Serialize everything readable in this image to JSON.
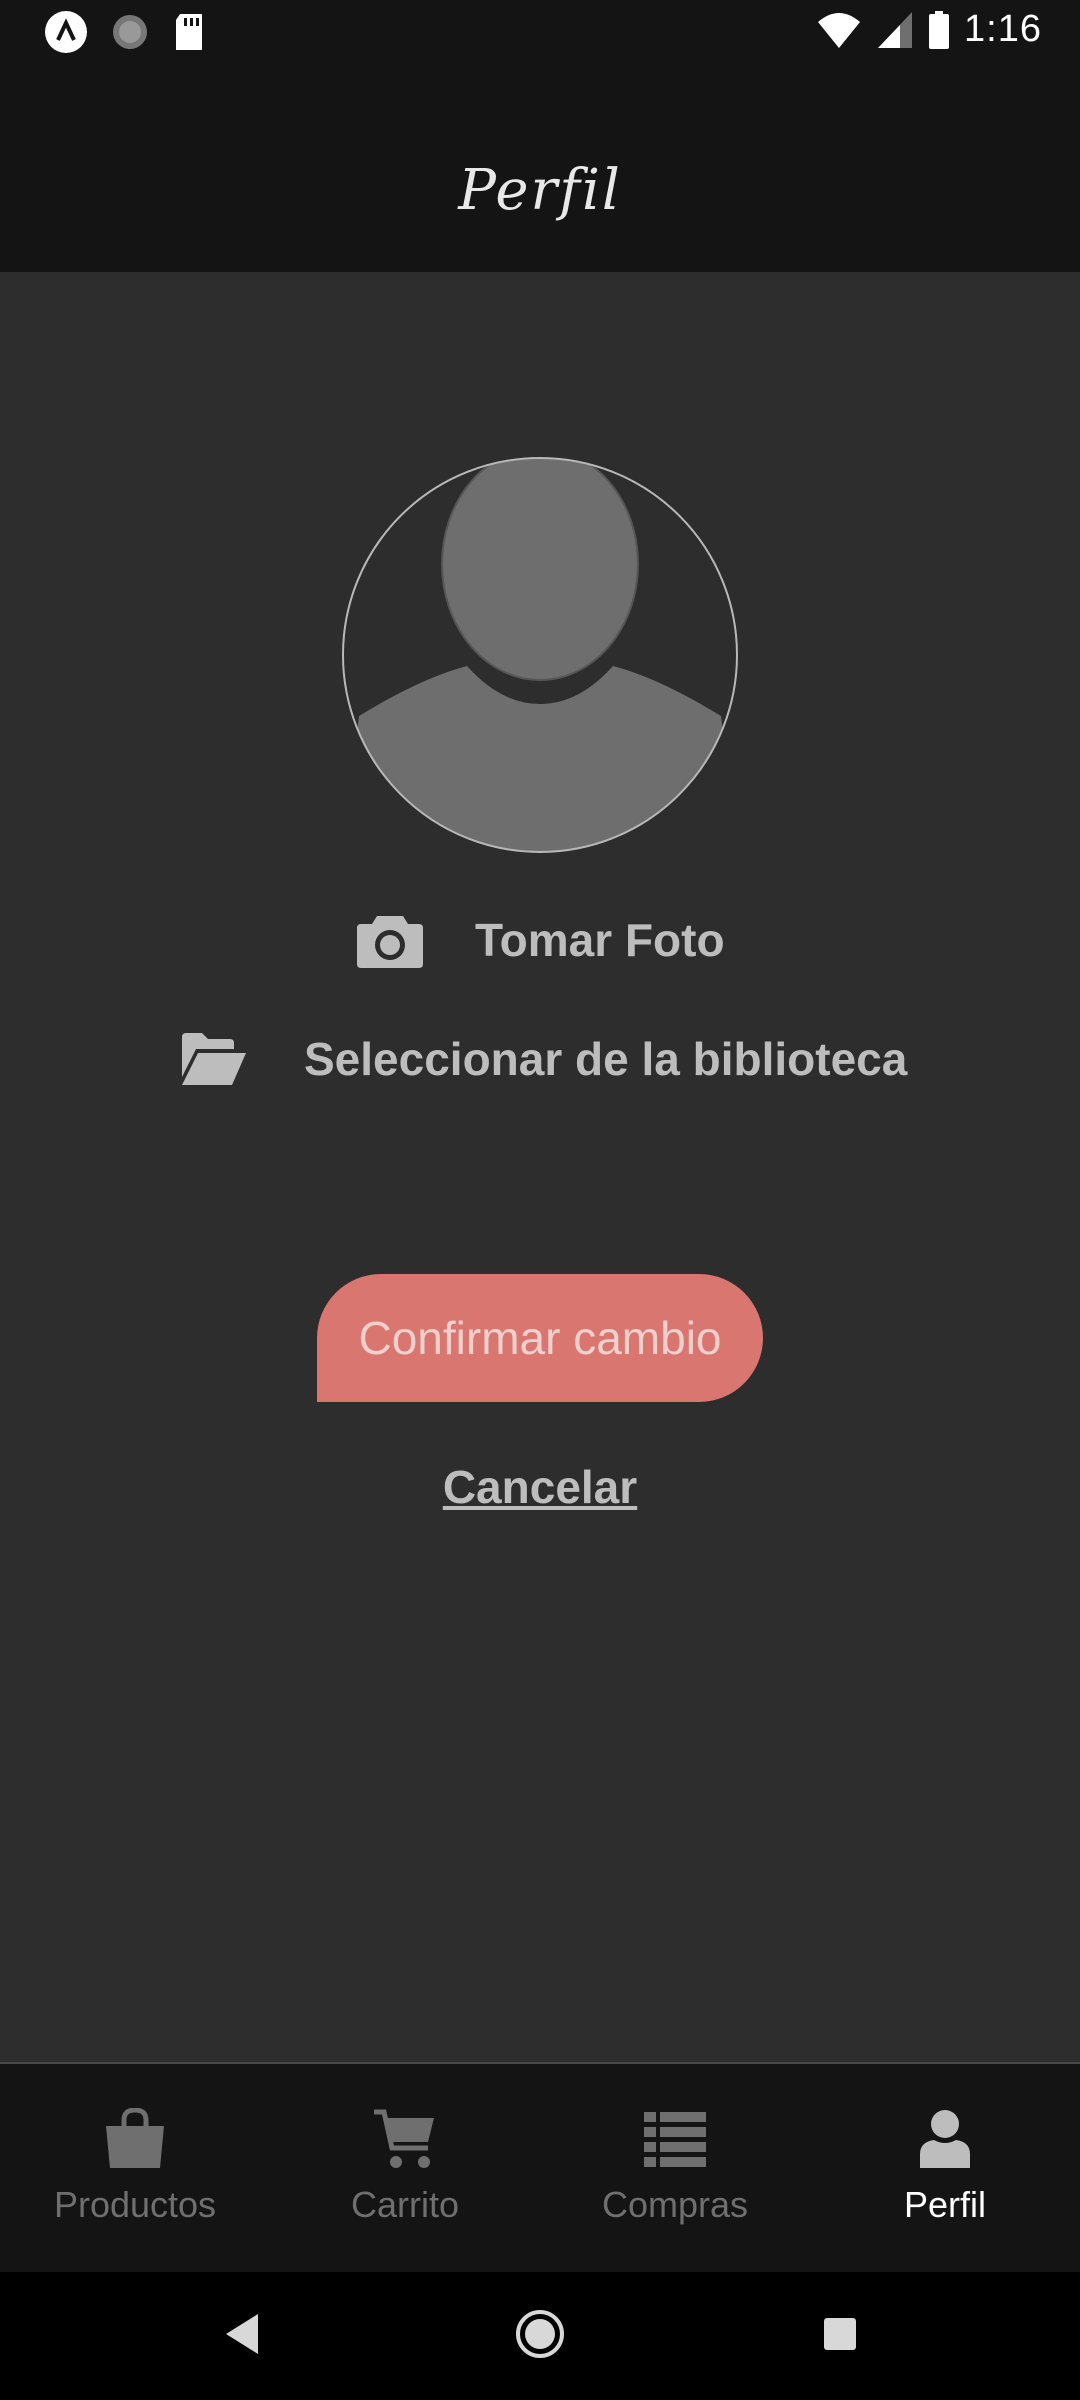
{
  "status_bar": {
    "time": "1:16",
    "icons": [
      "app-notification-icon",
      "loading-icon",
      "sd-card-icon",
      "wifi-icon",
      "signal-icon",
      "battery-icon"
    ]
  },
  "header": {
    "title": "Perfil"
  },
  "profile": {
    "avatar_icon": "default-user-avatar",
    "take_photo_label": "Tomar Foto",
    "select_library_label": "Seleccionar de la biblioteca",
    "confirm_label": "Confirmar cambio",
    "cancel_label": "Cancelar"
  },
  "tabs": [
    {
      "label": "Productos",
      "icon": "shopping-bag-icon",
      "active": false
    },
    {
      "label": "Carrito",
      "icon": "cart-icon",
      "active": false
    },
    {
      "label": "Compras",
      "icon": "list-icon",
      "active": false
    },
    {
      "label": "Perfil",
      "icon": "user-icon",
      "active": true
    }
  ],
  "nav_bar": {
    "buttons": [
      "back-icon",
      "home-icon",
      "recents-icon"
    ]
  },
  "colors": {
    "background": "#2d2d2d",
    "header_bg": "#141414",
    "confirm_button": "#d97670",
    "muted_text": "#bdbdbd",
    "inactive_tab": "#6f6f6f",
    "active_tab": "#ffffff"
  }
}
